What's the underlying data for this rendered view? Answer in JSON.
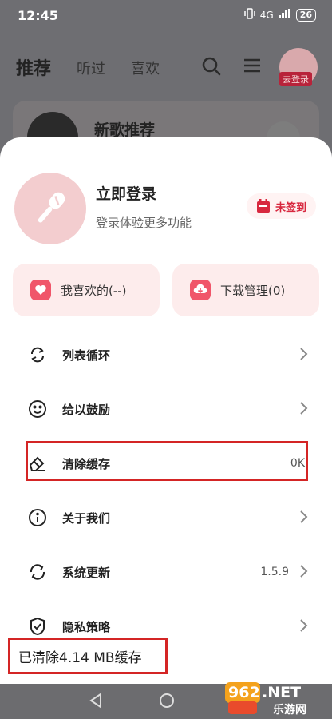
{
  "status_bar": {
    "time": "12:45",
    "network": "4G",
    "battery": "26"
  },
  "header": {
    "tabs": [
      {
        "label": "推荐"
      },
      {
        "label": "听过"
      },
      {
        "label": "喜欢"
      }
    ],
    "login_tag": "去登录"
  },
  "background_card": {
    "title": "新歌推荐"
  },
  "profile": {
    "name": "立即登录",
    "subtitle": "登录体验更多功能",
    "signin_label": "未签到"
  },
  "shortcuts": [
    {
      "label": "我喜欢的(--)",
      "icon": "heart-icon"
    },
    {
      "label": "下载管理(0)",
      "icon": "cloud-download-icon"
    }
  ],
  "menu": [
    {
      "label": "列表循环",
      "icon": "loop-icon",
      "value": ""
    },
    {
      "label": "给以鼓励",
      "icon": "smile-icon",
      "value": ""
    },
    {
      "label": "清除缓存",
      "icon": "eraser-icon",
      "value": "0K"
    },
    {
      "label": "关于我们",
      "icon": "info-icon",
      "value": ""
    },
    {
      "label": "系统更新",
      "icon": "refresh-icon",
      "value": "1.5.9"
    },
    {
      "label": "隐私策略",
      "icon": "shield-check-icon",
      "value": ""
    }
  ],
  "toast": "已清除4.14 MB缓存",
  "watermark": {
    "number": "962",
    "suffix": ".NET",
    "sub": "乐游网"
  },
  "colors": {
    "accent": "#d8283f",
    "highlight": "#d42525",
    "pink_bg": "#fdecec"
  }
}
